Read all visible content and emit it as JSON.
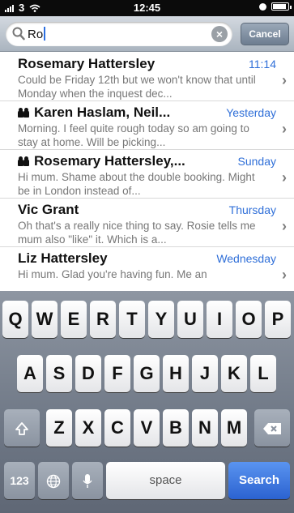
{
  "status_bar": {
    "carrier": "3",
    "time": "12:45",
    "battery_level": 0.9
  },
  "search": {
    "query": "Ro",
    "cancel_label": "Cancel"
  },
  "results": [
    {
      "name": "Rosemary Hattersley",
      "group": false,
      "date": "11:14",
      "preview": "Could be Friday 12th but we won't know that until Monday when the inquest dec..."
    },
    {
      "name": "Karen Haslam, Neil...",
      "group": true,
      "date": "Yesterday",
      "preview": "Morning. I feel quite rough today so am going to stay at home. Will be picking..."
    },
    {
      "name": "Rosemary Hattersley,...",
      "group": true,
      "date": "Sunday",
      "preview": "Hi mum. Shame about the double booking. Might be in London instead of..."
    },
    {
      "name": "Vic Grant",
      "group": false,
      "date": "Thursday",
      "preview": "Oh that's a really nice thing to say. Rosie tells me mum also \"like\" it. Which is a..."
    },
    {
      "name": "Liz Hattersley",
      "group": false,
      "date": "Wednesday",
      "preview": "Hi mum. Glad you're having fun. Me an"
    }
  ],
  "keyboard": {
    "row1": [
      "Q",
      "W",
      "E",
      "R",
      "T",
      "Y",
      "U",
      "I",
      "O",
      "P"
    ],
    "row2": [
      "A",
      "S",
      "D",
      "F",
      "G",
      "H",
      "J",
      "K",
      "L"
    ],
    "row3": [
      "Z",
      "X",
      "C",
      "V",
      "B",
      "N",
      "M"
    ],
    "numbers_label": "123",
    "space_label": "space",
    "search_label": "Search"
  },
  "colors": {
    "accent": "#2f6fd8",
    "search_key": "#2b62d0"
  }
}
